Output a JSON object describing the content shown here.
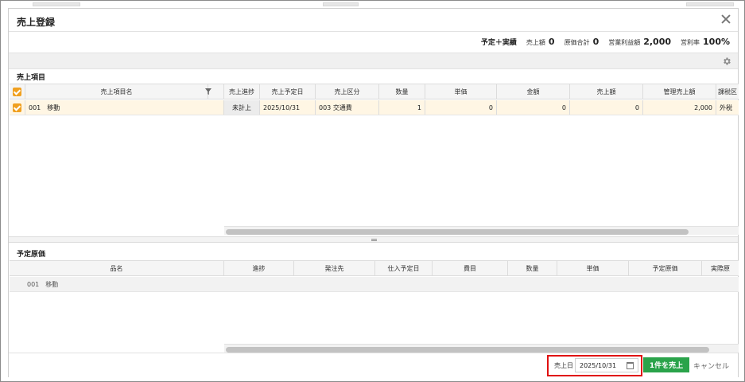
{
  "dialog": {
    "title": "売上登録"
  },
  "summary": {
    "mode": "予定＋実績",
    "items": [
      {
        "label": "売上額",
        "value": "0"
      },
      {
        "label": "原価合計",
        "value": "0"
      },
      {
        "label": "営業利益額",
        "value": "2,000"
      },
      {
        "label": "営利率",
        "value": "100%"
      }
    ]
  },
  "sales_items": {
    "section_title": "売上項目",
    "columns": [
      "売上項目名",
      "売上進捗",
      "売上予定日",
      "売上区分",
      "数量",
      "単価",
      "金額",
      "売上額",
      "管理売上額",
      "課税区"
    ],
    "rows": [
      {
        "name": "001　移動",
        "progress": "未計上",
        "planned_date": "2025/10/31",
        "category": "003 交通費",
        "quantity": "1",
        "unit_price": "0",
        "amount": "0",
        "sales_amount": "0",
        "managed_sales": "2,000",
        "tax": "外税"
      }
    ]
  },
  "planned_costs": {
    "section_title": "予定原価",
    "columns": [
      "品名",
      "進捗",
      "発注先",
      "仕入予定日",
      "費目",
      "数量",
      "単価",
      "予定原価",
      "実際原"
    ],
    "group_row": "001　移動"
  },
  "footer": {
    "date_label": "売上日",
    "date_value": "2025/10/31",
    "submit_label": "1件を売上",
    "cancel_label": "キャンセル"
  },
  "colors": {
    "accent": "#f0a020",
    "submit": "#2aa34a",
    "highlight": "#e01010"
  }
}
